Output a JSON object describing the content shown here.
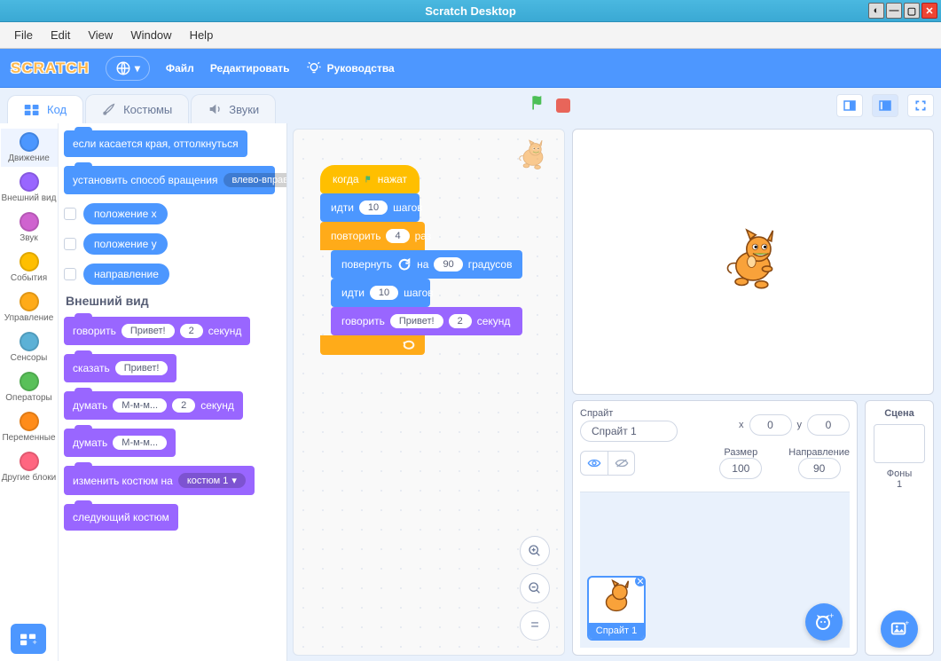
{
  "window": {
    "title": "Scratch Desktop"
  },
  "sysmenu": [
    "File",
    "Edit",
    "View",
    "Window",
    "Help"
  ],
  "topbar": {
    "logo": "SCRATCH",
    "file": "Файл",
    "edit": "Редактировать",
    "tutorials": "Руководства"
  },
  "tabs": {
    "code": "Код",
    "costumes": "Костюмы",
    "sounds": "Звуки"
  },
  "categories": [
    {
      "name": "Движение",
      "color": "#4c97ff"
    },
    {
      "name": "Внешний вид",
      "color": "#9966ff"
    },
    {
      "name": "Звук",
      "color": "#cf63cf"
    },
    {
      "name": "События",
      "color": "#ffbf00"
    },
    {
      "name": "Управление",
      "color": "#ffab19"
    },
    {
      "name": "Сенсоры",
      "color": "#5cb1d6"
    },
    {
      "name": "Операторы",
      "color": "#59c059"
    },
    {
      "name": "Переменные",
      "color": "#ff8c1a"
    },
    {
      "name": "Другие блоки",
      "color": "#ff6680"
    }
  ],
  "palette": {
    "motion_bounce": "если касается края, оттолкнуться",
    "motion_setrot_a": "установить способ вращения",
    "motion_setrot_b": "влево-вправо",
    "rep_x": "положение x",
    "rep_y": "положение y",
    "rep_dir": "направление",
    "looks_header": "Внешний вид",
    "say_secs_a": "говорить",
    "say_secs_b": "Привет!",
    "say_secs_c": "2",
    "say_secs_d": "секунд",
    "say_a": "сказать",
    "say_b": "Привет!",
    "think_secs_a": "думать",
    "think_secs_b": "М-м-м...",
    "think_secs_c": "2",
    "think_secs_d": "секунд",
    "think_a": "думать",
    "think_b": "М-м-м...",
    "sw_cost_a": "изменить костюм на",
    "sw_cost_b": "костюм 1",
    "next_cost": "следующий костюм"
  },
  "script": {
    "hat_a": "когда",
    "hat_b": "нажат",
    "move_a": "идти",
    "move_v": "10",
    "move_b": "шагов",
    "rep_a": "повторить",
    "rep_v": "4",
    "rep_b": "раз",
    "turn_a": "повернуть",
    "turn_b": "на",
    "turn_v": "90",
    "turn_c": "градусов",
    "move2_a": "идти",
    "move2_v": "10",
    "move2_b": "шагов",
    "say_a": "говорить",
    "say_v": "Привет!",
    "say_n": "2",
    "say_b": "секунд"
  },
  "sprite": {
    "label": "Спрайт",
    "name": "Спрайт 1",
    "xl": "x",
    "x": "0",
    "yl": "y",
    "y": "0",
    "sizelabel": "Размер",
    "size": "100",
    "dirlabel": "Направление",
    "dir": "90"
  },
  "scene": {
    "label": "Сцена",
    "backs": "Фоны",
    "count": "1"
  }
}
